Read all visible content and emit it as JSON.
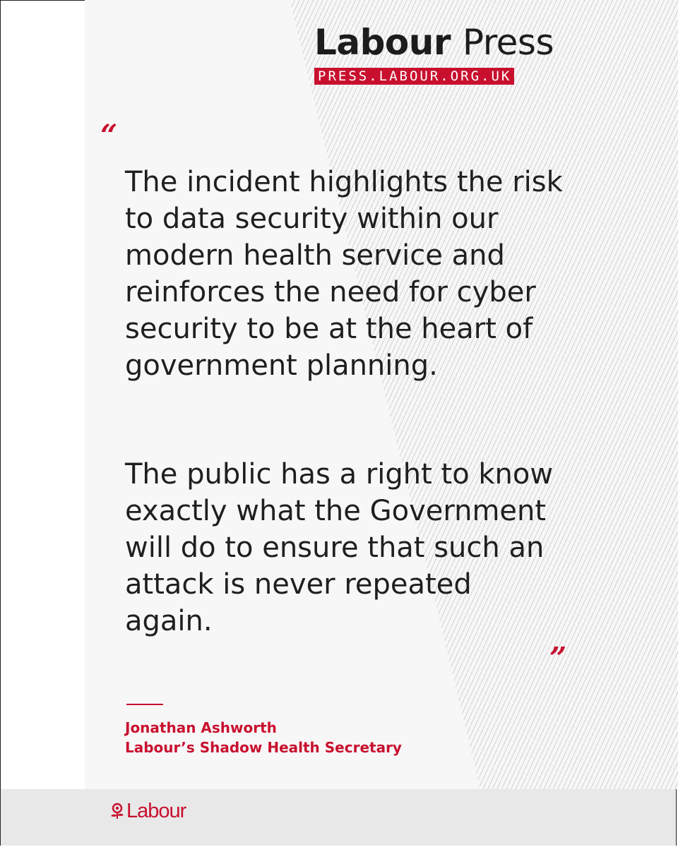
{
  "header": {
    "title_bold": "Labour",
    "title_light": "Press",
    "url": "PRESS.LABOUR.ORG.UK"
  },
  "quote": {
    "open_mark": "“",
    "close_mark": "”",
    "paragraph_1": "The incident highlights the risk to data security within our modern health service and reinforces the need for cyber security to be at the heart of government planning.",
    "paragraph_2": "The public has a right to know exactly what the Government will do to ensure that such an attack is never repeated again."
  },
  "attribution": {
    "name": "Jonathan Ashworth",
    "role": "Labour’s Shadow Health Secretary"
  },
  "footer": {
    "logo_text": "Labour",
    "logo_icon": "rose-icon"
  },
  "colors": {
    "accent": "#c8102e",
    "text": "#1f1f1f",
    "background": "#f8f7f8"
  }
}
